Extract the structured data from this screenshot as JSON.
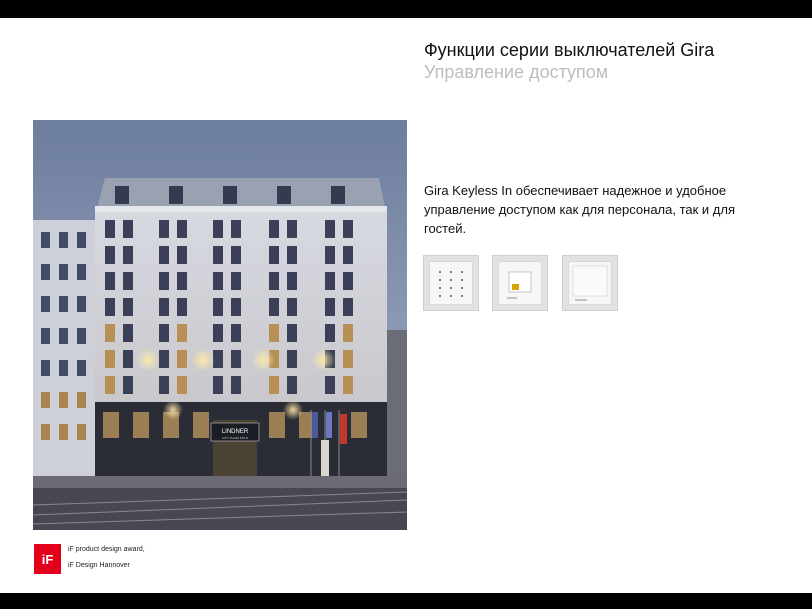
{
  "slide": {
    "title": "Функции серии выключателей Gira",
    "subtitle": "Управление доступом",
    "body": "Gira Keyless In обеспечивает надежное и удобное управление доступом как для персонала, так и для гостей.",
    "hotel_sign_line1": "LINDNER",
    "hotel_sign_line2": "CITY PLAZA KÖLN",
    "award_line1": "iF product design award,",
    "award_line2": "iF Design Hannover",
    "award_logo_text": "iF",
    "thumbnails": [
      {
        "icon": "keypad-icon"
      },
      {
        "icon": "card-reader-icon"
      },
      {
        "icon": "fingerprint-reader-icon"
      }
    ]
  }
}
